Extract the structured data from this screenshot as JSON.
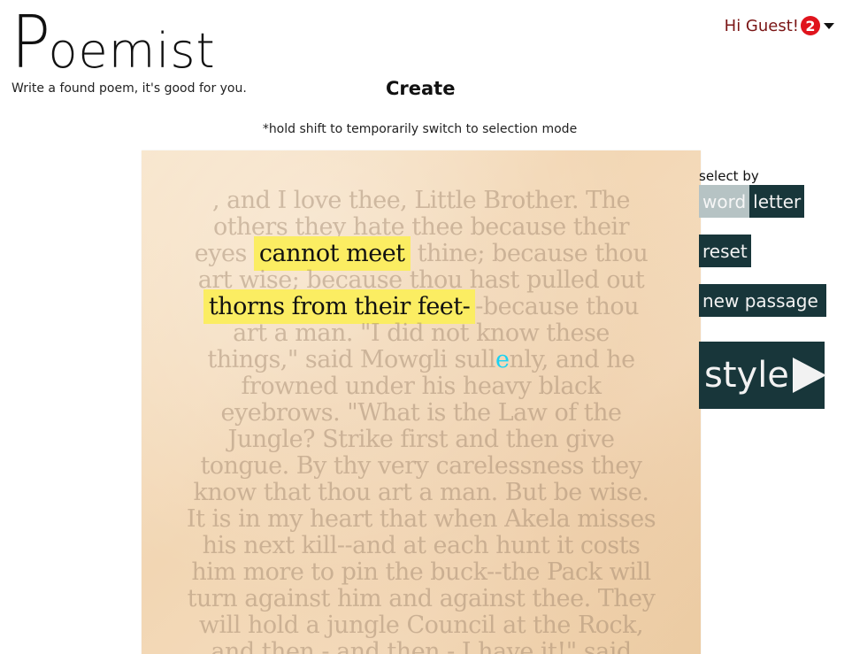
{
  "app": {
    "logo_first": "P",
    "logo_rest": "oemist",
    "tagline": "Write a found poem, it's good for you.",
    "page_title": "Create"
  },
  "user": {
    "greeting": "Hi Guest!",
    "notification_count": "2"
  },
  "hint": "*hold shift to temporarily switch to selection mode",
  "passage": {
    "lines": [
      [
        {
          "t": ", and I love thee, Little Brother. The"
        }
      ],
      [
        {
          "t": "others they hate thee because their"
        }
      ],
      [
        {
          "t": "eyes "
        },
        {
          "t": "cannot meet",
          "sel": true
        },
        {
          "t": " thine; because thou"
        }
      ],
      [
        {
          "t": "art wise; because thou hast pulled out"
        }
      ],
      [
        {
          "t": "thorns from their feet-",
          "sel": true
        },
        {
          "t": "-because thou"
        }
      ],
      [
        {
          "t": "art a man. \"I did not know these"
        }
      ],
      [
        {
          "t": "things,\" said Mowgli sull"
        },
        {
          "t": "e",
          "cursor": true
        },
        {
          "t": "nly, and he"
        }
      ],
      [
        {
          "t": "frowned under his heavy black"
        }
      ],
      [
        {
          "t": "eyebrows. \"What is the Law of the"
        }
      ],
      [
        {
          "t": "Jungle? Strike first and then give"
        }
      ],
      [
        {
          "t": "tongue. By thy very carelessness they"
        }
      ],
      [
        {
          "t": "know that thou art a man. But be wise."
        }
      ],
      [
        {
          "t": "It is in my heart that when Akela misses"
        }
      ],
      [
        {
          "t": "his next kill--and at each hunt it costs"
        }
      ],
      [
        {
          "t": "him more to pin the buck--the Pack will"
        }
      ],
      [
        {
          "t": "turn against him and against thee. They"
        }
      ],
      [
        {
          "t": "will hold a jungle Council at the Rock,"
        }
      ],
      [
        {
          "t": "and then - and then - I have it!\" said"
        }
      ]
    ]
  },
  "controls": {
    "select_by_label": "select by",
    "word_label": "word",
    "letter_label": "letter",
    "selected_mode": "word",
    "reset_label": "reset",
    "new_passage_label": "new passage",
    "style_label": "style"
  },
  "colors": {
    "highlight": "#fbed62",
    "button_bg": "#18363a",
    "active_segment": "#b6c3c4",
    "cursor_letter": "#1ad2f2",
    "badge": "#e0141d",
    "greeting": "#7a1515"
  }
}
